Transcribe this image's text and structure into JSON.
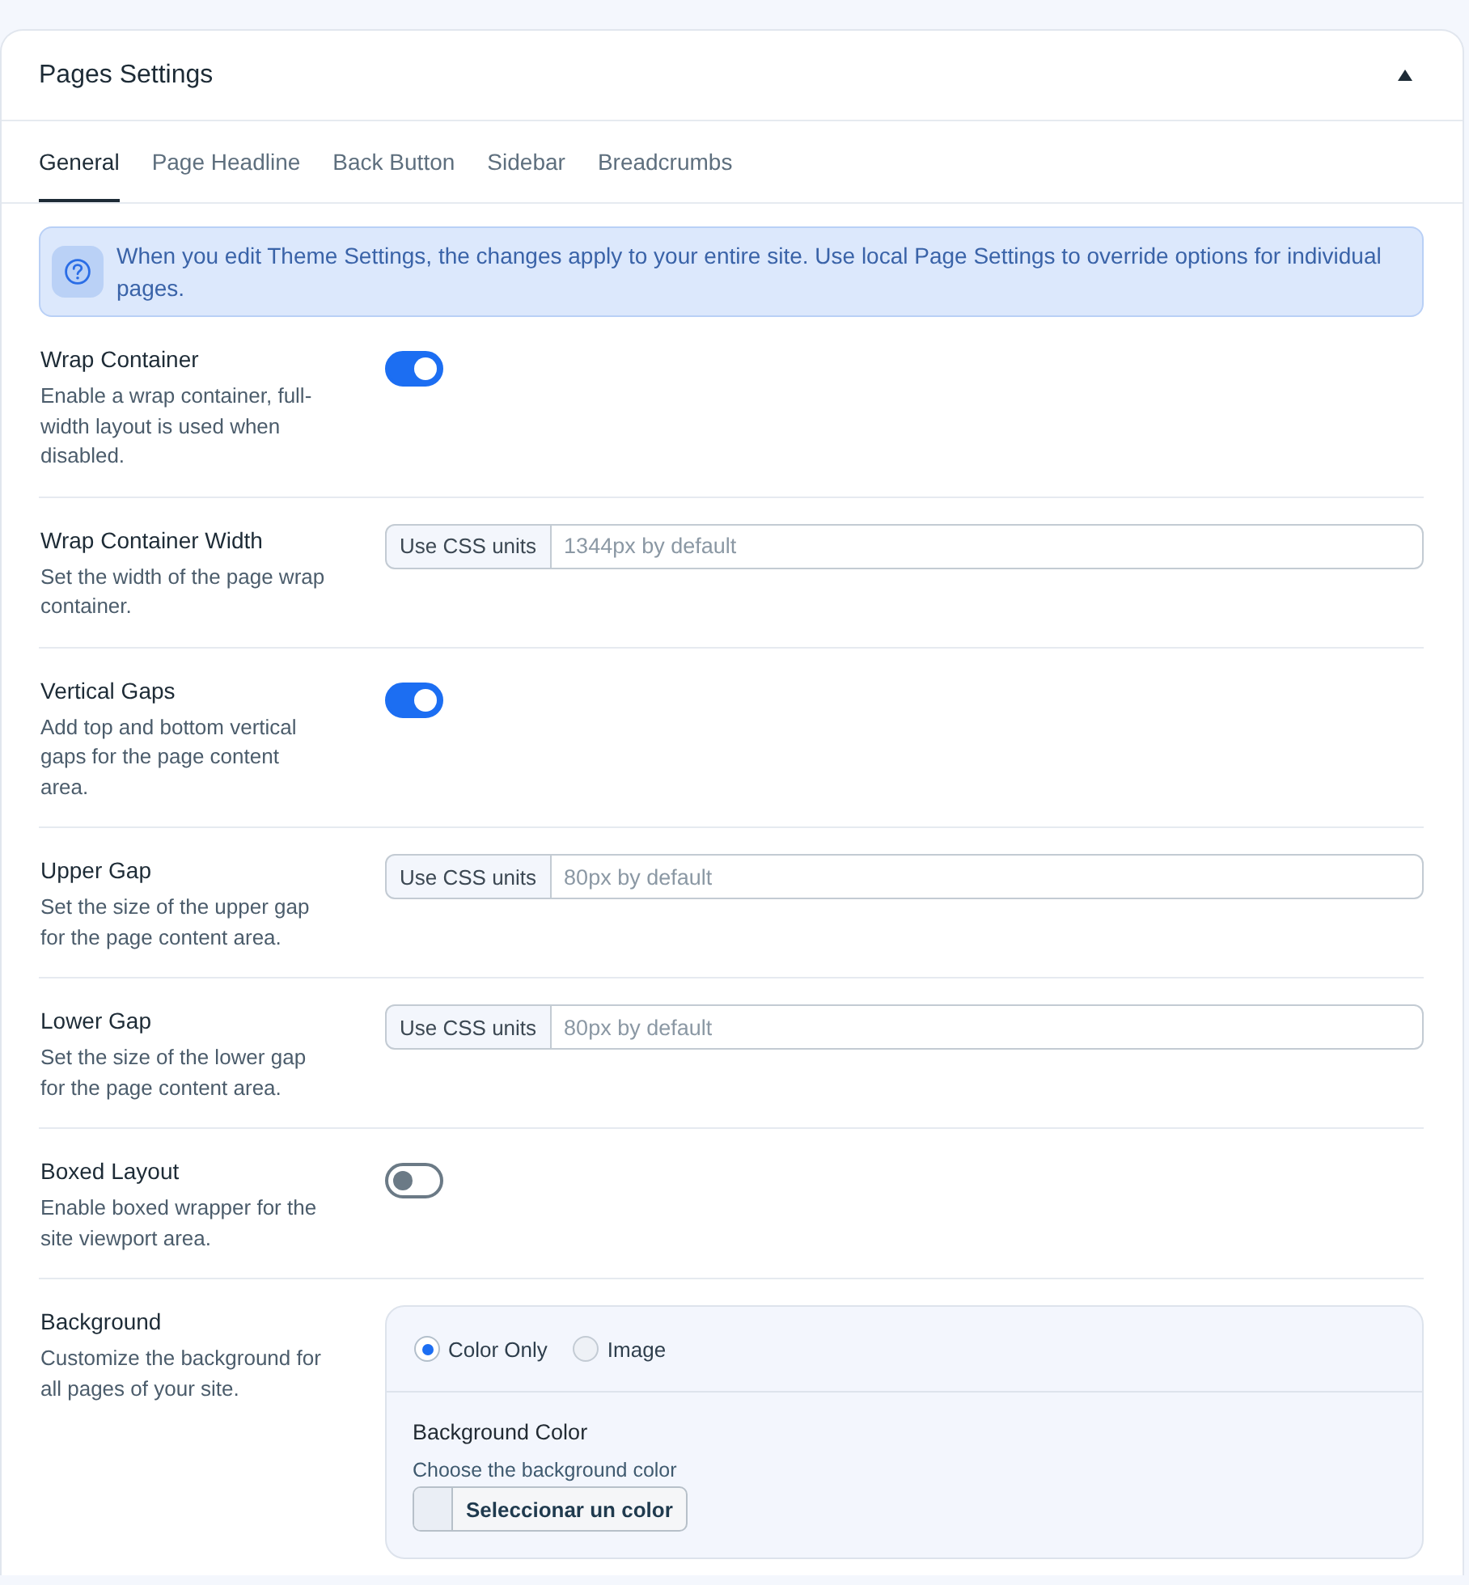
{
  "panel": {
    "title": "Pages Settings",
    "expanded": true
  },
  "tabs": [
    {
      "label": "General",
      "selected": true
    },
    {
      "label": "Page Headline",
      "selected": false
    },
    {
      "label": "Back Button",
      "selected": false
    },
    {
      "label": "Sidebar",
      "selected": false
    },
    {
      "label": "Breadcrumbs",
      "selected": false
    }
  ],
  "notice": {
    "text": "When you edit Theme Settings, the changes apply to your entire site. Use local Page Settings to override options for individual pages."
  },
  "settings": [
    {
      "kind": "toggle",
      "label": "Wrap Container",
      "description": "Enable a wrap container, full-width layout is used when disabled.",
      "on": true
    },
    {
      "kind": "units",
      "label": "Wrap Container Width",
      "description": "Set the width of the page wrap container.",
      "prefix": "Use CSS units",
      "placeholder": "1344px by default"
    },
    {
      "kind": "toggle",
      "label": "Vertical Gaps",
      "description": "Add top and bottom vertical gaps for the page content area.",
      "on": true
    },
    {
      "kind": "units",
      "label": "Upper Gap",
      "description": "Set the size of the upper gap for the page content area.",
      "prefix": "Use CSS units",
      "placeholder": "80px by default"
    },
    {
      "kind": "units",
      "label": "Lower Gap",
      "description": "Set the size of the lower gap for the page content area.",
      "prefix": "Use CSS units",
      "placeholder": "80px by default"
    },
    {
      "kind": "toggle",
      "label": "Boxed Layout",
      "description": "Enable boxed wrapper for the site viewport area.",
      "on": false
    },
    {
      "kind": "background",
      "label": "Background",
      "description": "Customize the background for all pages of your site.",
      "options": [
        {
          "label": "Color Only",
          "selected": true
        },
        {
          "label": "Image",
          "selected": false
        }
      ],
      "color_label": "Background Color",
      "color_description": "Choose the background color",
      "color_button": "Seleccionar un color"
    }
  ]
}
